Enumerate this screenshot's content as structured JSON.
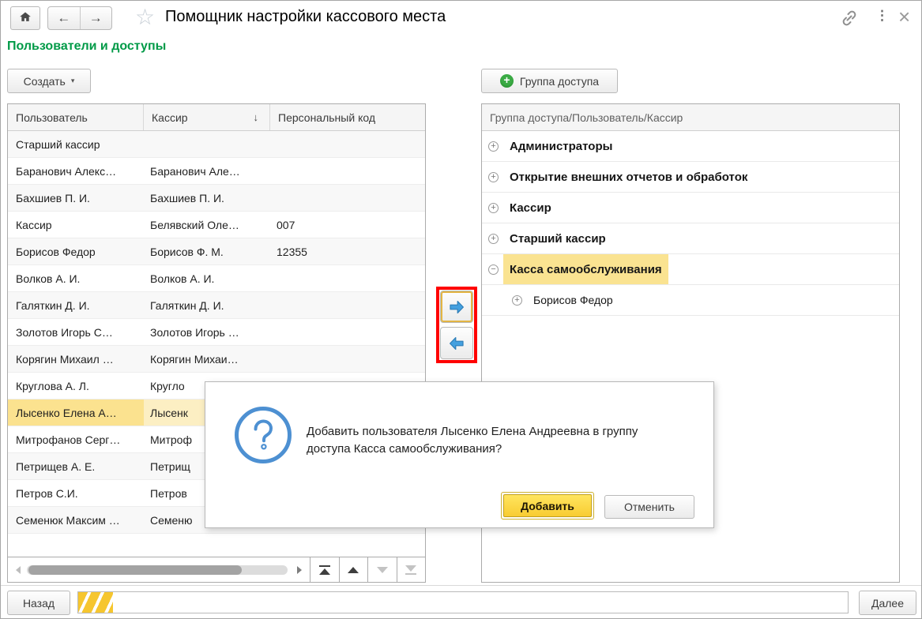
{
  "header": {
    "title": "Помощник настройки кассового места"
  },
  "icons": {
    "back": "←",
    "forward": "→",
    "star": "☆",
    "kebab": "⋮",
    "close": "×",
    "caret": "▾",
    "sort_desc": "↓",
    "plus": "+",
    "expand": "+",
    "collapse": "−"
  },
  "section_title": "Пользователи и доступы",
  "left_panel": {
    "create_button": "Создать",
    "table": {
      "columns": {
        "user": "Пользователь",
        "cashier": "Кассир",
        "code": "Персональный код"
      },
      "sorted_column": "Кассир",
      "rows": [
        {
          "user": "Старший кассир",
          "cashier": "",
          "code": ""
        },
        {
          "user": "Баранович Алекс…",
          "cashier": "Баранович Але…",
          "code": ""
        },
        {
          "user": "Бахшиев П. И.",
          "cashier": "Бахшиев П. И.",
          "code": ""
        },
        {
          "user": "Кассир",
          "cashier": "Белявский Оле…",
          "code": "007"
        },
        {
          "user": "Борисов Федор",
          "cashier": "Борисов Ф. М.",
          "code": "12355"
        },
        {
          "user": "Волков А. И.",
          "cashier": "Волков А. И.",
          "code": ""
        },
        {
          "user": "Галяткин Д. И.",
          "cashier": "Галяткин Д. И.",
          "code": ""
        },
        {
          "user": "Золотов Игорь С…",
          "cashier": "Золотов Игорь …",
          "code": ""
        },
        {
          "user": "Корягин Михаил …",
          "cashier": "Корягин Михаи…",
          "code": ""
        },
        {
          "user": "Круглова А. Л.",
          "cashier": "Кругло",
          "code": ""
        },
        {
          "user": "Лысенко Елена А…",
          "cashier": "Лысенк",
          "code": "",
          "selected": true
        },
        {
          "user": "Митрофанов Серг…",
          "cashier": "Митроф",
          "code": ""
        },
        {
          "user": "Петрищев А. Е.",
          "cashier": "Петрищ",
          "code": ""
        },
        {
          "user": "Петров С.И.",
          "cashier": "Петров",
          "code": ""
        },
        {
          "user": "Семенюк Максим …",
          "cashier": "Семеню",
          "code": ""
        }
      ]
    }
  },
  "right_panel": {
    "add_group_button": "Группа доступа",
    "tree_header": "Группа доступа/Пользователь/Кассир",
    "groups": [
      {
        "label": "Администраторы",
        "toggle": "+"
      },
      {
        "label": "Открытие внешних отчетов и обработок",
        "toggle": "+"
      },
      {
        "label": "Кассир",
        "toggle": "+"
      },
      {
        "label": "Старший кассир",
        "toggle": "+"
      },
      {
        "label": "Касса самообслуживания",
        "toggle": "−",
        "selected": true
      }
    ],
    "child_item": {
      "label": "Борисов Федор",
      "toggle": "+"
    }
  },
  "dialog": {
    "message": "Добавить пользователя Лысенко Елена Андреевна в группу доступа Касса самообслуживания?",
    "confirm_label": "Добавить",
    "cancel_label": "Отменить"
  },
  "footer": {
    "back_label": "Назад",
    "next_label": "Далее",
    "progress_percent": 4
  },
  "colors": {
    "accent_green": "#009A47",
    "selection_yellow": "#FBE28F",
    "tree_selection_yellow": "#FAE391",
    "annotation_red": "#FF0000",
    "arrow_blue": "#44A0DF",
    "confirm_button_yellow": "#F8CC32",
    "dialog_icon_blue": "#4D90D2",
    "progress_yellow": "#F6C62F"
  }
}
